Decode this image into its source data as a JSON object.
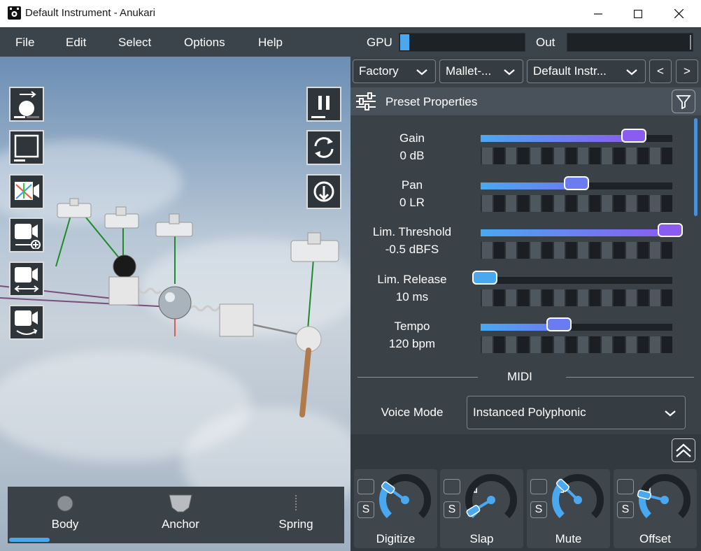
{
  "window": {
    "title": "Default Instrument - Anukari"
  },
  "menu": [
    "File",
    "Edit",
    "Select",
    "Options",
    "Help"
  ],
  "meters": {
    "gpu_label": "GPU",
    "out_label": "Out",
    "gpu_level": 0.07
  },
  "bottom_bar": {
    "items": [
      "Body",
      "Anchor",
      "Spring"
    ]
  },
  "preset_bar": {
    "category": "Factory",
    "subcategory": "Mallet-...",
    "preset": "Default Instr...",
    "prev_label": "<",
    "next_label": ">"
  },
  "properties": {
    "header": "Preset Properties",
    "params": [
      {
        "name": "Gain",
        "value": "0 dB",
        "level": 0.8
      },
      {
        "name": "Pan",
        "value": "0 LR",
        "level": 0.5
      },
      {
        "name": "Lim. Threshold",
        "value": "-0.5 dBFS",
        "level": 0.99
      },
      {
        "name": "Lim. Release",
        "value": "10 ms",
        "level": 0.01
      },
      {
        "name": "Tempo",
        "value": "120 bpm",
        "level": 0.41
      }
    ],
    "midi_section": "MIDI",
    "voice_mode_label": "Voice Mode",
    "voice_mode_value": "Instanced Polyphonic"
  },
  "macros": [
    {
      "label": "Digitize",
      "solo": "S",
      "level": 0.3
    },
    {
      "label": "Slap",
      "solo": "S",
      "level": 0.05
    },
    {
      "label": "Mute",
      "solo": "S",
      "level": 0.33
    },
    {
      "label": "Offset",
      "solo": "S",
      "level": 0.22
    }
  ],
  "colors": {
    "accent_blue": "#4aa8f0",
    "accent_purple": "#8b5cf0",
    "knob_blue": "#4aa8f0"
  }
}
